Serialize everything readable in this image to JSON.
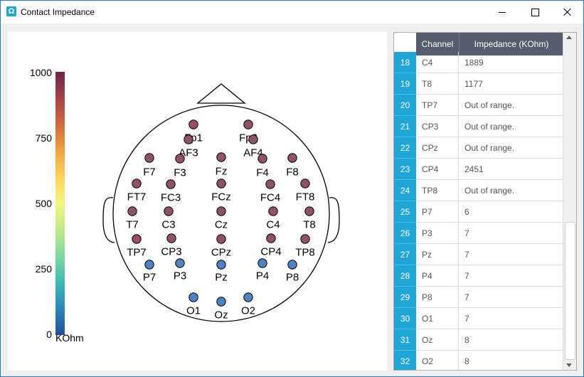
{
  "window": {
    "title": "Contact Impedance",
    "icon": "omega-icon"
  },
  "colorbar": {
    "ticks": [
      "1000",
      "750",
      "500",
      "250",
      "0"
    ],
    "unit": "KOhm"
  },
  "electrodes": [
    {
      "label": "Fp1",
      "color": "#8e5466"
    },
    {
      "label": "Fp2",
      "color": "#8e5466"
    },
    {
      "label": "AF3",
      "color": "#8e5466"
    },
    {
      "label": "AF4",
      "color": "#8e5466"
    },
    {
      "label": "F7",
      "color": "#8e5466"
    },
    {
      "label": "F3",
      "color": "#8e5466"
    },
    {
      "label": "Fz",
      "color": "#8e5466"
    },
    {
      "label": "F4",
      "color": "#8e5466"
    },
    {
      "label": "F8",
      "color": "#8e5466"
    },
    {
      "label": "FT7",
      "color": "#8e5466"
    },
    {
      "label": "FC3",
      "color": "#8e5466"
    },
    {
      "label": "FCz",
      "color": "#8e5466"
    },
    {
      "label": "FC4",
      "color": "#8e5466"
    },
    {
      "label": "FT8",
      "color": "#8e5466"
    },
    {
      "label": "T7",
      "color": "#8e5466"
    },
    {
      "label": "C3",
      "color": "#8e5466"
    },
    {
      "label": "Cz",
      "color": "#8e5466"
    },
    {
      "label": "C4",
      "color": "#8e5466"
    },
    {
      "label": "T8",
      "color": "#8e5466"
    },
    {
      "label": "TP7",
      "color": "#8e5466"
    },
    {
      "label": "CP3",
      "color": "#8e5466"
    },
    {
      "label": "CPz",
      "color": "#8e5466"
    },
    {
      "label": "CP4",
      "color": "#8e5466"
    },
    {
      "label": "TP8",
      "color": "#8e5466"
    },
    {
      "label": "P7",
      "color": "#4e82c0"
    },
    {
      "label": "P3",
      "color": "#4e82c0"
    },
    {
      "label": "Pz",
      "color": "#4e82c0"
    },
    {
      "label": "P4",
      "color": "#4e82c0"
    },
    {
      "label": "P8",
      "color": "#4e82c0"
    },
    {
      "label": "O1",
      "color": "#4e82c0"
    },
    {
      "label": "Oz",
      "color": "#4e82c0"
    },
    {
      "label": "O2",
      "color": "#4e82c0"
    }
  ],
  "table": {
    "headers": {
      "channel": "Channel",
      "impedance": "Impedance (KOhm)"
    },
    "rows": [
      {
        "num": "18",
        "channel": "C4",
        "impedance": "1889"
      },
      {
        "num": "19",
        "channel": "T8",
        "impedance": "1177"
      },
      {
        "num": "20",
        "channel": "TP7",
        "impedance": "Out of range."
      },
      {
        "num": "21",
        "channel": "CP3",
        "impedance": "Out of range."
      },
      {
        "num": "22",
        "channel": "CPz",
        "impedance": "Out of range."
      },
      {
        "num": "23",
        "channel": "CP4",
        "impedance": "2451"
      },
      {
        "num": "24",
        "channel": "TP8",
        "impedance": "Out of range."
      },
      {
        "num": "25",
        "channel": "P7",
        "impedance": "6"
      },
      {
        "num": "26",
        "channel": "P3",
        "impedance": "7"
      },
      {
        "num": "27",
        "channel": "Pz",
        "impedance": "7"
      },
      {
        "num": "28",
        "channel": "P4",
        "impedance": "7"
      },
      {
        "num": "29",
        "channel": "P8",
        "impedance": "7"
      },
      {
        "num": "30",
        "channel": "O1",
        "impedance": "7"
      },
      {
        "num": "31",
        "channel": "Oz",
        "impedance": "8"
      },
      {
        "num": "32",
        "channel": "O2",
        "impedance": "8"
      }
    ]
  }
}
